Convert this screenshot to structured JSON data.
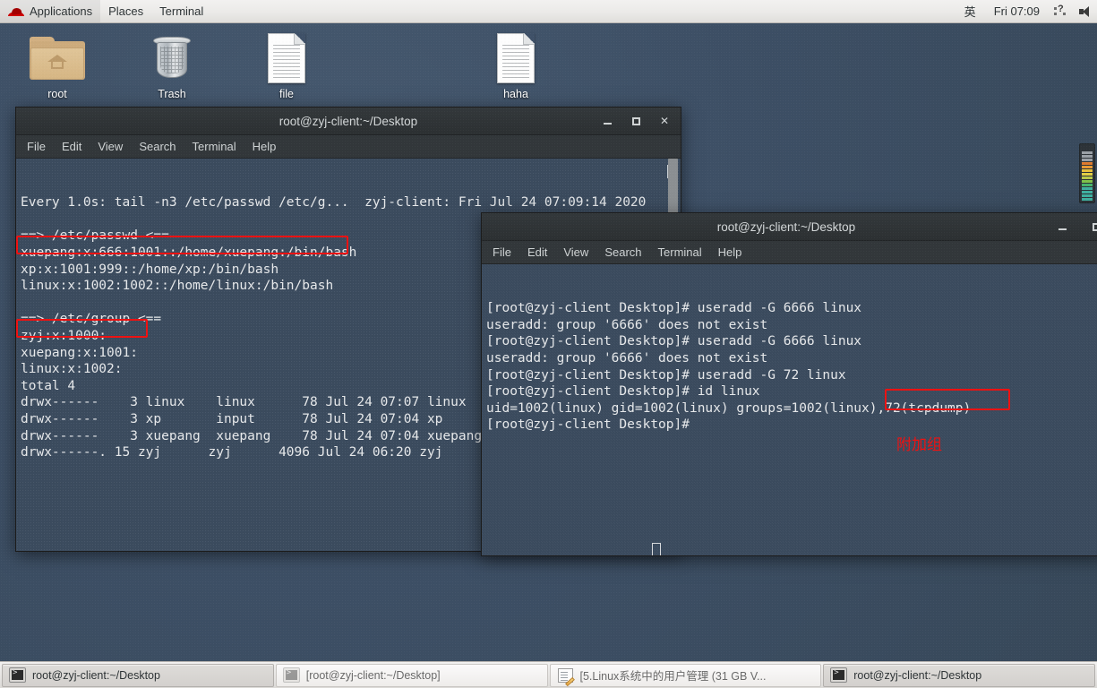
{
  "top_panel": {
    "logo_icon": "redhat-logo-icon",
    "items": [
      "Applications",
      "Places",
      "Terminal"
    ],
    "ime_indicator": "英",
    "clock": "Fri 07:09",
    "tray": [
      "help-tray-icon",
      "speaker-tray-icon"
    ]
  },
  "desktop": {
    "icons": [
      {
        "label": "root",
        "icon": "home-folder-icon",
        "type": "folder"
      },
      {
        "label": "Trash",
        "icon": "trash-can-icon",
        "type": "trash"
      },
      {
        "label": "file",
        "icon": "document-icon",
        "type": "doc"
      },
      {
        "label": "haha",
        "icon": "document-icon",
        "type": "doc"
      }
    ]
  },
  "window1": {
    "title": "root@zyj-client:~/Desktop",
    "menus": [
      "File",
      "Edit",
      "View",
      "Search",
      "Terminal",
      "Help"
    ],
    "controls": {
      "minimize": "minimize-icon",
      "maximize": "maximize-icon",
      "close": "close-icon"
    },
    "lines": [
      "Every 1.0s: tail -n3 /etc/passwd /etc/g...  zyj-client: Fri Jul 24 07:09:14 2020",
      "",
      "==> /etc/passwd <==",
      "xuepang:x:666:1001::/home/xuepang:/bin/bash",
      "xp:x:1001:999::/home/xp:/bin/bash",
      "linux:x:1002:1002::/home/linux:/bin/bash",
      "",
      "==> /etc/group <==",
      "zyj:x:1000:",
      "xuepang:x:1001:",
      "linux:x:1002:",
      "total 4",
      "drwx------    3 linux    linux      78 Jul 24 07:07 linux",
      "drwx------    3 xp       input      78 Jul 24 07:04 xp",
      "drwx------    3 xuepang  xuepang    78 Jul 24 07:04 xuepang",
      "drwx------. 15 zyj      zyj      4096 Jul 24 06:20 zyj"
    ],
    "highlights": [
      {
        "name": "passwd-linux-entry-highlight",
        "text": "linux:x:1002:1002::/home/linux:/bin/bash"
      },
      {
        "name": "group-linux-entry-highlight",
        "text": "linux:x:1002:"
      }
    ]
  },
  "window2": {
    "title": "root@zyj-client:~/Desktop",
    "menus": [
      "File",
      "Edit",
      "View",
      "Search",
      "Terminal",
      "Help"
    ],
    "controls": {
      "minimize": "minimize-icon",
      "maximize": "maximize-icon"
    },
    "lines": [
      "[root@zyj-client Desktop]# useradd -G 6666 linux",
      "useradd: group '6666' does not exist",
      "[root@zyj-client Desktop]# useradd -G 6666 linux",
      "useradd: group '6666' does not exist",
      "[root@zyj-client Desktop]# useradd -G 72 linux",
      "[root@zyj-client Desktop]# id linux",
      "uid=1002(linux) gid=1002(linux) groups=1002(linux),72(tcpdump)",
      "[root@zyj-client Desktop]#"
    ],
    "highlights": [
      {
        "name": "supplementary-group-highlight",
        "text": "72(tcpdump)"
      }
    ],
    "annotation": "附加组"
  },
  "taskbar": {
    "buttons": [
      {
        "label": "root@zyj-client:~/Desktop",
        "icon": "terminal-icon",
        "state": "active"
      },
      {
        "label": "[root@zyj-client:~/Desktop]",
        "icon": "terminal-icon",
        "state": "inactive"
      },
      {
        "label": "[5.Linux系统中的用户管理 (31 GB V...",
        "icon": "notes-icon",
        "state": "inactive"
      },
      {
        "label": "root@zyj-client:~/Desktop",
        "icon": "terminal-icon",
        "state": "active"
      }
    ]
  },
  "sysmon": {
    "name": "system-monitor-applet",
    "bars": [
      "#3fb0a0",
      "#3fb0a0",
      "#3fb0a0",
      "#3fb0a0",
      "#46b36c",
      "#7ec24a",
      "#b9c94a",
      "#e2cf45",
      "#e8c03c",
      "#e89a35",
      "#e07b2e",
      "#9aa0a6",
      "#9aa0a6",
      "#9aa0a6"
    ]
  },
  "colors": {
    "accent_red": "#ee1111",
    "panel_bg": "#ebeae8",
    "terminal_bg": "#3b4b5e",
    "titlebar_bg": "#2f3437",
    "desktop_bg": "#3f5168"
  }
}
